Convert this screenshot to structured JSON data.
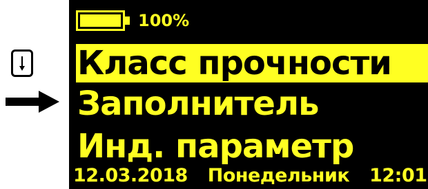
{
  "annotations": {
    "key_icon": "arrow-down-key-icon",
    "pointer_icon": "arrow-right-icon"
  },
  "status": {
    "battery_icon": "battery-icon",
    "battery_level": "100%"
  },
  "menu": {
    "items": [
      {
        "label": "Класс прочности",
        "selected": true
      },
      {
        "label": "Заполнитель",
        "selected": false
      },
      {
        "label": "Инд. параметр",
        "selected": false
      }
    ]
  },
  "footer": {
    "date": "12.03.2018",
    "weekday": "Понедельник",
    "time": "12:01"
  },
  "colors": {
    "screen_bg": "#000000",
    "text": "#ffff22",
    "highlight": "#ffff22"
  }
}
